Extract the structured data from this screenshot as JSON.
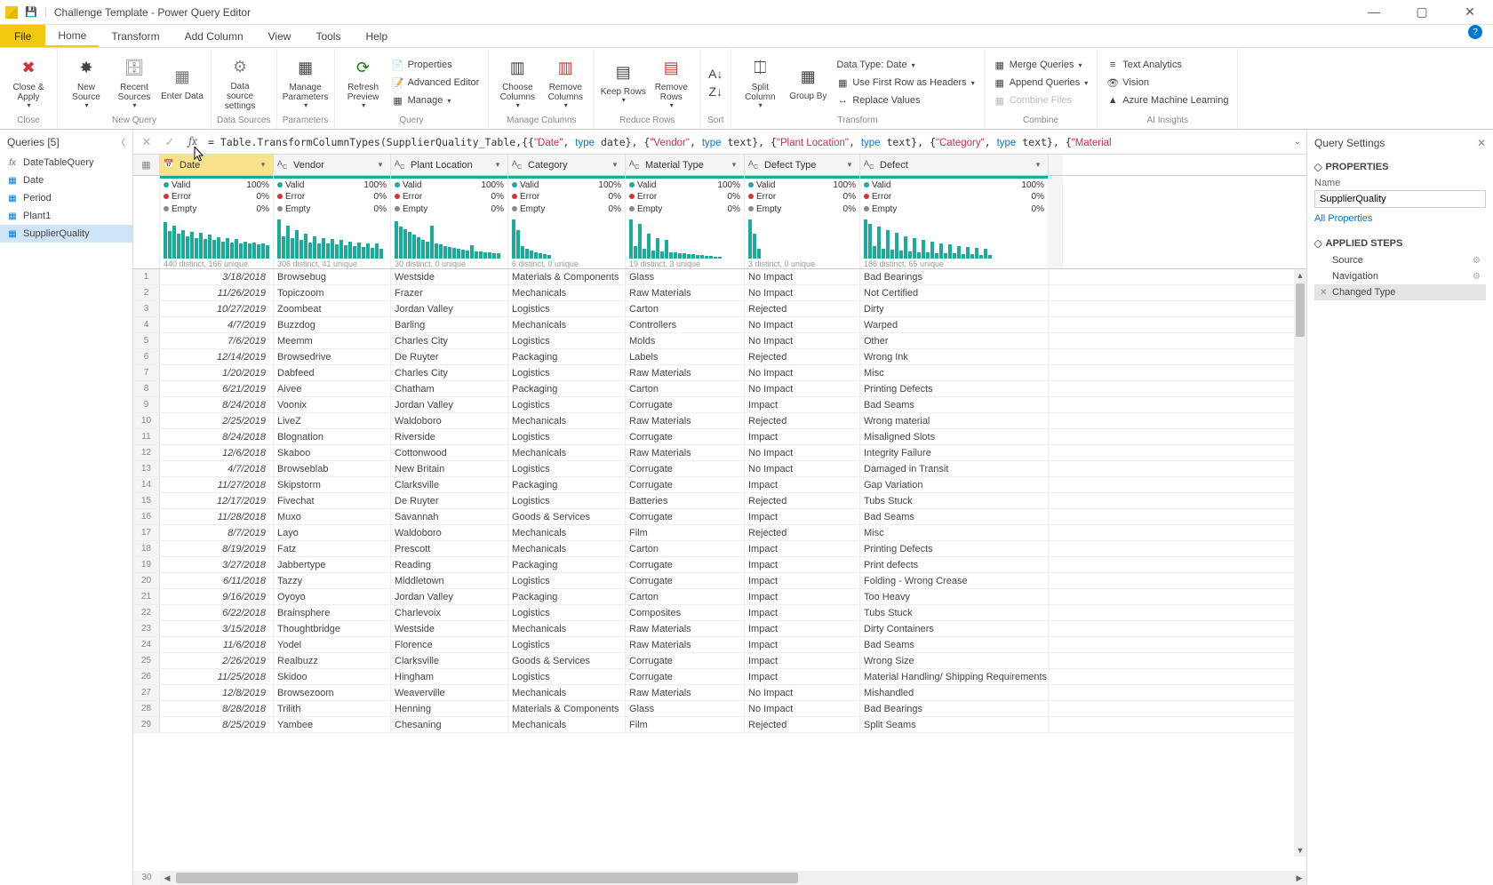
{
  "title": "Challenge Template - Power Query Editor",
  "ribbon_tabs": [
    "File",
    "Home",
    "Transform",
    "Add Column",
    "View",
    "Tools",
    "Help"
  ],
  "ribbon": {
    "close": {
      "close_apply": "Close &\nApply",
      "group": "Close"
    },
    "new_query": {
      "new_source": "New\nSource",
      "recent": "Recent\nSources",
      "enter": "Enter\nData",
      "group": "New Query"
    },
    "data_sources": {
      "btn": "Data source\nsettings",
      "group": "Data Sources"
    },
    "parameters": {
      "btn": "Manage\nParameters",
      "group": "Parameters"
    },
    "query": {
      "refresh": "Refresh\nPreview",
      "props": "Properties",
      "adv": "Advanced Editor",
      "manage": "Manage",
      "group": "Query"
    },
    "manage_cols": {
      "choose": "Choose\nColumns",
      "remove": "Remove\nColumns",
      "group": "Manage Columns"
    },
    "reduce": {
      "keep": "Keep\nRows",
      "remove": "Remove\nRows",
      "group": "Reduce Rows"
    },
    "sort": {
      "group": "Sort"
    },
    "transform": {
      "split": "Split\nColumn",
      "group_by": "Group\nBy",
      "dtype": "Data Type: Date",
      "first_row": "Use First Row as Headers",
      "replace": "Replace Values",
      "group": "Transform"
    },
    "combine": {
      "merge": "Merge Queries",
      "append": "Append Queries",
      "combine": "Combine Files",
      "group": "Combine"
    },
    "ai": {
      "text": "Text Analytics",
      "vision": "Vision",
      "aml": "Azure Machine Learning",
      "group": "AI Insights"
    }
  },
  "queries_header": "Queries [5]",
  "queries": [
    {
      "name": "DateTableQuery",
      "type": "fx"
    },
    {
      "name": "Date",
      "type": "tbl"
    },
    {
      "name": "Period",
      "type": "tbl"
    },
    {
      "name": "Plant1",
      "type": "tbl"
    },
    {
      "name": "SupplierQuality",
      "type": "tbl",
      "sel": true
    }
  ],
  "formula_prefix": "= Table.TransformColumnTypes(SupplierQuality_Table,{{",
  "formula_segs": [
    {
      "t": "\"Date\"",
      "c": "r"
    },
    {
      "t": ", "
    },
    {
      "t": "type",
      "c": "b"
    },
    {
      "t": " date}, {"
    },
    {
      "t": "\"Vendor\"",
      "c": "r"
    },
    {
      "t": ", "
    },
    {
      "t": "type",
      "c": "b"
    },
    {
      "t": " text}, {"
    },
    {
      "t": "\"Plant Location\"",
      "c": "r"
    },
    {
      "t": ", "
    },
    {
      "t": "type",
      "c": "b"
    },
    {
      "t": " text}, {"
    },
    {
      "t": "\"Category\"",
      "c": "r"
    },
    {
      "t": ", "
    },
    {
      "t": "type",
      "c": "b"
    },
    {
      "t": " text}, {"
    },
    {
      "t": "\"Material",
      "c": "r"
    }
  ],
  "columns": [
    {
      "name": "Date",
      "type": "📅",
      "w": "w-date"
    },
    {
      "name": "Vendor",
      "type": "ABC",
      "w": "w-vendor"
    },
    {
      "name": "Plant Location",
      "type": "ABC",
      "w": "w-plant"
    },
    {
      "name": "Category",
      "type": "ABC",
      "w": "w-cat"
    },
    {
      "name": "Material Type",
      "type": "ABC",
      "w": "w-mat"
    },
    {
      "name": "Defect Type",
      "type": "ABC",
      "w": "w-dtype"
    },
    {
      "name": "Defect",
      "type": "ABC",
      "w": "w-defect"
    }
  ],
  "quality_labels": {
    "valid": "Valid",
    "error": "Error",
    "empty": "Empty"
  },
  "quality_pcts": {
    "valid": "100%",
    "error": "0%",
    "empty": "0%"
  },
  "distinct": [
    "440 distinct, 166 unique",
    "306 distinct, 41 unique",
    "30 distinct, 0 unique",
    "6 distinct, 0 unique",
    "19 distinct, 3 unique",
    "3 distinct, 0 unique",
    "186 distinct, 65 unique"
  ],
  "spark": [
    [
      90,
      68,
      80,
      60,
      70,
      55,
      65,
      50,
      62,
      48,
      58,
      45,
      52,
      42,
      50,
      40,
      48,
      38,
      42,
      36,
      40,
      34,
      38,
      32
    ],
    [
      95,
      55,
      80,
      50,
      70,
      45,
      60,
      40,
      55,
      38,
      50,
      36,
      48,
      34,
      45,
      32,
      42,
      30,
      40,
      28,
      38,
      26,
      36,
      25
    ],
    [
      92,
      78,
      72,
      66,
      58,
      52,
      46,
      42,
      80,
      38,
      34,
      30,
      28,
      26,
      24,
      22,
      20,
      32,
      18,
      17,
      16,
      15,
      14,
      13
    ],
    [
      95,
      70,
      30,
      25,
      20,
      15,
      12,
      10,
      8
    ],
    [
      95,
      30,
      85,
      25,
      60,
      20,
      50,
      18,
      45,
      16,
      15,
      14,
      12,
      11,
      10,
      9,
      8,
      7,
      6,
      5,
      4
    ],
    [
      95,
      60,
      25
    ],
    [
      95,
      85,
      30,
      78,
      25,
      70,
      22,
      62,
      20,
      55,
      18,
      50,
      16,
      46,
      15,
      42,
      14,
      38,
      13,
      34,
      12,
      30,
      11,
      28,
      10,
      26,
      9,
      24,
      8
    ]
  ],
  "rows": [
    [
      "3/18/2018",
      "Browsebug",
      "Westside",
      "Materials & Components",
      "Glass",
      "No Impact",
      "Bad Bearings"
    ],
    [
      "11/26/2019",
      "Topiczoom",
      "Frazer",
      "Mechanicals",
      "Raw Materials",
      "No Impact",
      "Not Certified"
    ],
    [
      "10/27/2019",
      "Zoombeat",
      "Jordan Valley",
      "Logistics",
      "Carton",
      "Rejected",
      "Dirty"
    ],
    [
      "4/7/2019",
      "Buzzdog",
      "Barling",
      "Mechanicals",
      "Controllers",
      "No Impact",
      "Warped"
    ],
    [
      "7/6/2019",
      "Meemm",
      "Charles City",
      "Logistics",
      "Molds",
      "No Impact",
      "Other"
    ],
    [
      "12/14/2019",
      "Browsedrive",
      "De Ruyter",
      "Packaging",
      "Labels",
      "Rejected",
      "Wrong Ink"
    ],
    [
      "1/20/2019",
      "Dabfeed",
      "Charles City",
      "Logistics",
      "Raw Materials",
      "No Impact",
      "Misc"
    ],
    [
      "6/21/2019",
      "Aivee",
      "Chatham",
      "Packaging",
      "Carton",
      "No Impact",
      "Printing Defects"
    ],
    [
      "8/24/2018",
      "Voonix",
      "Jordan Valley",
      "Logistics",
      "Corrugate",
      "Impact",
      "Bad Seams"
    ],
    [
      "2/25/2019",
      "LiveZ",
      "Waldoboro",
      "Mechanicals",
      "Raw Materials",
      "Rejected",
      "Wrong material"
    ],
    [
      "8/24/2018",
      "Blognation",
      "Riverside",
      "Logistics",
      "Corrugate",
      "Impact",
      "Misaligned Slots"
    ],
    [
      "12/6/2018",
      "Skaboo",
      "Cottonwood",
      "Mechanicals",
      "Raw Materials",
      "No Impact",
      "Integrity Failure"
    ],
    [
      "4/7/2018",
      "Browseblab",
      "New Britain",
      "Logistics",
      "Corrugate",
      "No Impact",
      "Damaged in Transit"
    ],
    [
      "11/27/2018",
      "Skipstorm",
      "Clarksville",
      "Packaging",
      "Corrugate",
      "Impact",
      "Gap Variation"
    ],
    [
      "12/17/2019",
      "Fivechat",
      "De Ruyter",
      "Logistics",
      "Batteries",
      "Rejected",
      "Tubs Stuck"
    ],
    [
      "11/28/2018",
      "Muxo",
      "Savannah",
      "Goods & Services",
      "Corrugate",
      "Impact",
      "Bad Seams"
    ],
    [
      "8/7/2019",
      "Layo",
      "Waldoboro",
      "Mechanicals",
      "Film",
      "Rejected",
      "Misc"
    ],
    [
      "8/19/2019",
      "Fatz",
      "Prescott",
      "Mechanicals",
      "Carton",
      "Impact",
      "Printing Defects"
    ],
    [
      "3/27/2018",
      "Jabbertype",
      "Reading",
      "Packaging",
      "Corrugate",
      "Impact",
      "Print defects"
    ],
    [
      "6/11/2018",
      "Tazzy",
      "Middletown",
      "Logistics",
      "Corrugate",
      "Impact",
      "Folding - Wrong Crease"
    ],
    [
      "9/16/2019",
      "Oyoyo",
      "Jordan Valley",
      "Packaging",
      "Carton",
      "Impact",
      "Too Heavy"
    ],
    [
      "6/22/2018",
      "Brainsphere",
      "Charlevoix",
      "Logistics",
      "Composites",
      "Impact",
      "Tubs Stuck"
    ],
    [
      "3/15/2018",
      "Thoughtbridge",
      "Westside",
      "Mechanicals",
      "Raw Materials",
      "Impact",
      "Dirty Containers"
    ],
    [
      "11/6/2018",
      "Yodel",
      "Florence",
      "Logistics",
      "Raw Materials",
      "Impact",
      "Bad Seams"
    ],
    [
      "2/26/2019",
      "Realbuzz",
      "Clarksville",
      "Goods & Services",
      "Corrugate",
      "Impact",
      "Wrong Size"
    ],
    [
      "11/25/2018",
      "Skidoo",
      "Hingham",
      "Logistics",
      "Corrugate",
      "Impact",
      "Material Handling/ Shipping Requirements Error"
    ],
    [
      "12/8/2019",
      "Browsezoom",
      "Weaverville",
      "Mechanicals",
      "Raw Materials",
      "No Impact",
      "Mishandled"
    ],
    [
      "8/28/2018",
      "Trilith",
      "Henning",
      "Materials & Components",
      "Glass",
      "No Impact",
      "Bad Bearings"
    ],
    [
      "8/25/2019",
      "Yambee",
      "Chesaning",
      "Mechanicals",
      "Film",
      "Rejected",
      "Split Seams"
    ]
  ],
  "settings": {
    "header": "Query Settings",
    "properties": "PROPERTIES",
    "name_label": "Name",
    "name_value": "SupplierQuality",
    "all_props": "All Properties",
    "steps": "APPLIED STEPS",
    "step_list": [
      {
        "name": "Source",
        "gear": true
      },
      {
        "name": "Navigation",
        "gear": true
      },
      {
        "name": "Changed Type",
        "sel": true,
        "del": true
      }
    ]
  }
}
